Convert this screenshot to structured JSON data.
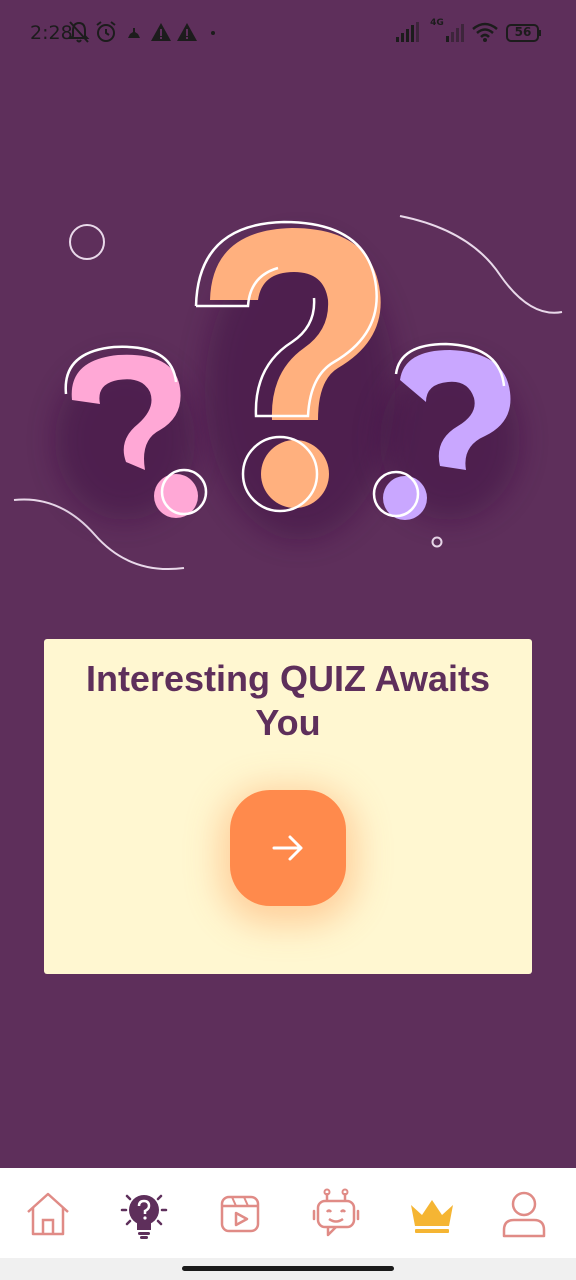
{
  "status_bar": {
    "time": "2:28",
    "battery": "56",
    "network_label": "4G",
    "icons_left": [
      "mute-bell-icon",
      "alarm-icon",
      "notification-icon",
      "warning-icon",
      "warning-icon",
      "dot-icon"
    ],
    "icons_right": [
      "signal-icon",
      "signal-4g-icon",
      "wifi-icon",
      "battery-icon"
    ]
  },
  "hero": {
    "image": "question-marks-illustration",
    "colors": {
      "pink": "#ffa8d6",
      "orange": "#ffb07e",
      "purple": "#c9a7ff"
    }
  },
  "quiz_card": {
    "title": "Interesting QUIZ Awaits You",
    "start_icon": "arrow-right-icon",
    "button_color": "#ff8a4c",
    "card_color": "#fff7d1"
  },
  "bottom_nav": {
    "items": [
      {
        "icon": "home-icon",
        "active": false
      },
      {
        "icon": "quiz-bulb-icon",
        "active": true
      },
      {
        "icon": "video-icon",
        "active": false
      },
      {
        "icon": "robot-icon",
        "active": false
      },
      {
        "icon": "crown-icon",
        "active": false
      },
      {
        "icon": "profile-icon",
        "active": false
      }
    ],
    "colors": {
      "inactive": "#e08b86",
      "active": "#5e2f5b",
      "crown": "#f5b533"
    }
  }
}
